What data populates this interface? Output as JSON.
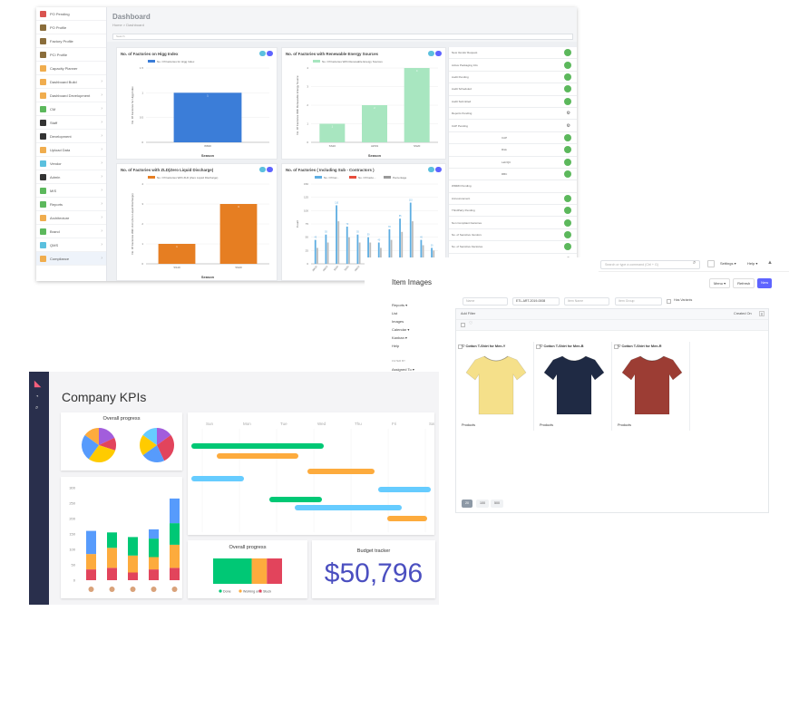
{
  "dashboard": {
    "title": "Dashboard",
    "breadcrumb": "Home > Dashboard",
    "search_placeholder": "Search",
    "sidebar": [
      {
        "label": "PO Pending",
        "color": "#d9534f"
      },
      {
        "label": "PO Profile",
        "color": "#8a6d3b"
      },
      {
        "label": "Factory Profile",
        "color": "#8a6d3b"
      },
      {
        "label": "PCI Profile",
        "color": "#8a6d3b"
      },
      {
        "label": "Capacity Planner",
        "color": "#f0ad4e"
      },
      {
        "label": "Dashboard Build",
        "color": "#f0ad4e"
      },
      {
        "label": "Dashboard Development",
        "color": "#f0ad4e"
      },
      {
        "label": "CM",
        "color": "#5cb85c"
      },
      {
        "label": "Staff",
        "color": "#333"
      },
      {
        "label": "Development",
        "color": "#333"
      },
      {
        "label": "Upload Data",
        "color": "#f0ad4e"
      },
      {
        "label": "Vendor",
        "color": "#5bc0de"
      },
      {
        "label": "Admin",
        "color": "#333"
      },
      {
        "label": "MIS",
        "color": "#5cb85c"
      },
      {
        "label": "Reports",
        "color": "#5cb85c"
      },
      {
        "label": "Architecture",
        "color": "#f0ad4e"
      },
      {
        "label": "Brand",
        "color": "#5cb85c"
      },
      {
        "label": "QMS",
        "color": "#5bc0de"
      },
      {
        "label": "Compliance",
        "color": "#f0ad4e"
      }
    ],
    "charts": [
      {
        "title": "No. of Factories on Higg Index",
        "legend": "No. Of Factories for Higg Index",
        "ylabel": "No. Of Factories for Higg Index",
        "xlabel": "Season",
        "categories": [
          "W820"
        ],
        "values": [
          1
        ],
        "ylim": [
          0,
          1.5
        ],
        "ticks": [
          "1.5",
          "1",
          "0.5",
          "0"
        ],
        "color": "#3b7dd8"
      },
      {
        "title": "No. of Factories with Renewable Energy Sources",
        "legend": "No. Of Factories With Renewable Energy Sources",
        "ylabel": "No. Of Factories With Renewable Energy Source",
        "xlabel": "Season",
        "categories": [
          "SS20",
          "AW19",
          "SS20"
        ],
        "values": [
          1,
          2,
          4
        ],
        "ylim": [
          0,
          4
        ],
        "ticks": [
          "4",
          "3",
          "2",
          "1",
          "0"
        ],
        "color": "#a8e6c0"
      },
      {
        "title": "No. of Factories with ZLD(Zero Liquid Discharge)",
        "legend": "No. Of Factories With ZLD (Zero Liquid Discharge)",
        "ylabel": "No. Of Factories With ZLD (Zero Liquid Discharge)",
        "xlabel": "Season",
        "categories": [
          "SS19",
          "SS20"
        ],
        "values": [
          1,
          3
        ],
        "ylim": [
          0,
          4
        ],
        "ticks": [
          "4",
          "3",
          "2",
          "1",
          "0"
        ],
        "color": "#e67e22"
      },
      {
        "title": "No. of Factories ( Including Sub - Contractors )",
        "legend_items": [
          "No. Of Fac...",
          "No. Of Facto...",
          "Percentage"
        ],
        "ylabel": "Count",
        "xlabel": "Season",
        "ylim": [
          0,
          150
        ],
        "ticks": [
          "150",
          "125",
          "100",
          "75",
          "50",
          "25",
          "0"
        ],
        "categories": [
          "AW19",
          "AW19",
          "SS20",
          "SS20",
          "AW19",
          "SS20",
          "SS20",
          "SS20",
          "AW19",
          "AW20",
          "SS21",
          "AW21"
        ],
        "series": [
          {
            "name": "No. Of Fac...",
            "values": [
              45,
              55,
              110,
              70,
              55,
              50,
              40,
              65,
              85,
              115,
              45,
              30
            ]
          },
          {
            "name": "No. Of Facto...",
            "values": [
              30,
              40,
              80,
              50,
              40,
              40,
              30,
              45,
              60,
              80,
              35,
              25
            ]
          }
        ]
      }
    ],
    "right_list": [
      {
        "label": "New Vendor Request",
        "status": "dot"
      },
      {
        "label": "Active Packaging Info",
        "status": "dot"
      },
      {
        "label": "Audit Pending",
        "status": "dot"
      },
      {
        "label": "Audit Scheduled",
        "status": "dot"
      },
      {
        "label": "Audit Submitted",
        "status": "dot"
      },
      {
        "label": "Reports Pending",
        "status": "gear"
      },
      {
        "label": "CAP Pending",
        "status": "gear"
      },
      {
        "label": "CAP",
        "status": "dot",
        "sub": true
      },
      {
        "label": "Risk",
        "status": "dot",
        "sub": true
      },
      {
        "label": "Lab/QC",
        "status": "dot",
        "sub": true
      },
      {
        "label": "RBC",
        "status": "dot",
        "sub": true
      },
      {
        "label": "WMRD Pending",
        "status": "none"
      },
      {
        "label": "Announcement",
        "status": "dot"
      },
      {
        "label": "ThirdParty Pending",
        "status": "dot"
      },
      {
        "label": "Non Compliant Factories",
        "status": "dot"
      },
      {
        "label": "No. of Sensitive Vendors",
        "status": "dot"
      },
      {
        "label": "No. of Sensitive Factories",
        "status": "dot"
      },
      {
        "label": "No. of Audit Done",
        "status": "gear"
      }
    ]
  },
  "items": {
    "search_placeholder": "Search or type a command (Ctrl + G)",
    "settings": "Settings",
    "help": "Help",
    "title": "Item Images",
    "menu": "Menu",
    "refresh": "Refresh",
    "new": "New",
    "sidebar": [
      "Reports",
      "List",
      "Images",
      "Calendar",
      "Kanban",
      "Help"
    ],
    "filter_by": "FILTER BY",
    "assigned_to": "Assigned To",
    "filters": {
      "name": "Name",
      "item_code": "ETL-ART-2019-0008",
      "item_name": "Item Name",
      "item_group": "Item Group",
      "has_variants": "Has Variants"
    },
    "add_filter": "Add Filter",
    "created_on": "Created On",
    "cards": [
      {
        "title": "Cotton T-Shirt for Men-Y",
        "footer": "Products",
        "color": "#f5e08a"
      },
      {
        "title": "Cotton T-Shirt for Men-B",
        "footer": "Products",
        "color": "#1f2a44"
      },
      {
        "title": "Cotton T-Shirt for Men-R",
        "footer": "Products",
        "color": "#9c3d34"
      }
    ],
    "page_sizes": [
      "20",
      "100",
      "500"
    ]
  },
  "kpi": {
    "title": "Company KPIs",
    "overall_progress_title": "Overall progress",
    "overall_progress_title2": "Overall progress",
    "budget_title": "Budget tracker",
    "budget_value": "$50,796",
    "days": [
      "Sun",
      "Mon",
      "Tue",
      "Wed",
      "Thu",
      "Fri",
      "Sat"
    ],
    "legend": [
      "Done",
      "Working on it",
      "Stuck"
    ],
    "colors": {
      "done": "#00c875",
      "working": "#fdab3d",
      "stuck": "#e2445c",
      "blue": "#579bfc",
      "purple": "#a25ddc",
      "yellow": "#ffcb00",
      "cyan": "#66ccff"
    },
    "bar_ticks": [
      "300",
      "250",
      "200",
      "150",
      "100",
      "50",
      "0"
    ],
    "stacked": [
      {
        "stuck": 35,
        "working": 50,
        "done": 0,
        "blue": 75
      },
      {
        "stuck": 40,
        "working": 65,
        "done": 50,
        "blue": 0
      },
      {
        "stuck": 25,
        "working": 55,
        "done": 60,
        "blue": 0
      },
      {
        "stuck": 35,
        "working": 40,
        "done": 60,
        "blue": 30
      },
      {
        "stuck": 40,
        "working": 75,
        "done": 70,
        "blue": 80
      }
    ],
    "overall_split": {
      "done": 0.56,
      "working": 0.22,
      "stuck": 0.22
    }
  }
}
